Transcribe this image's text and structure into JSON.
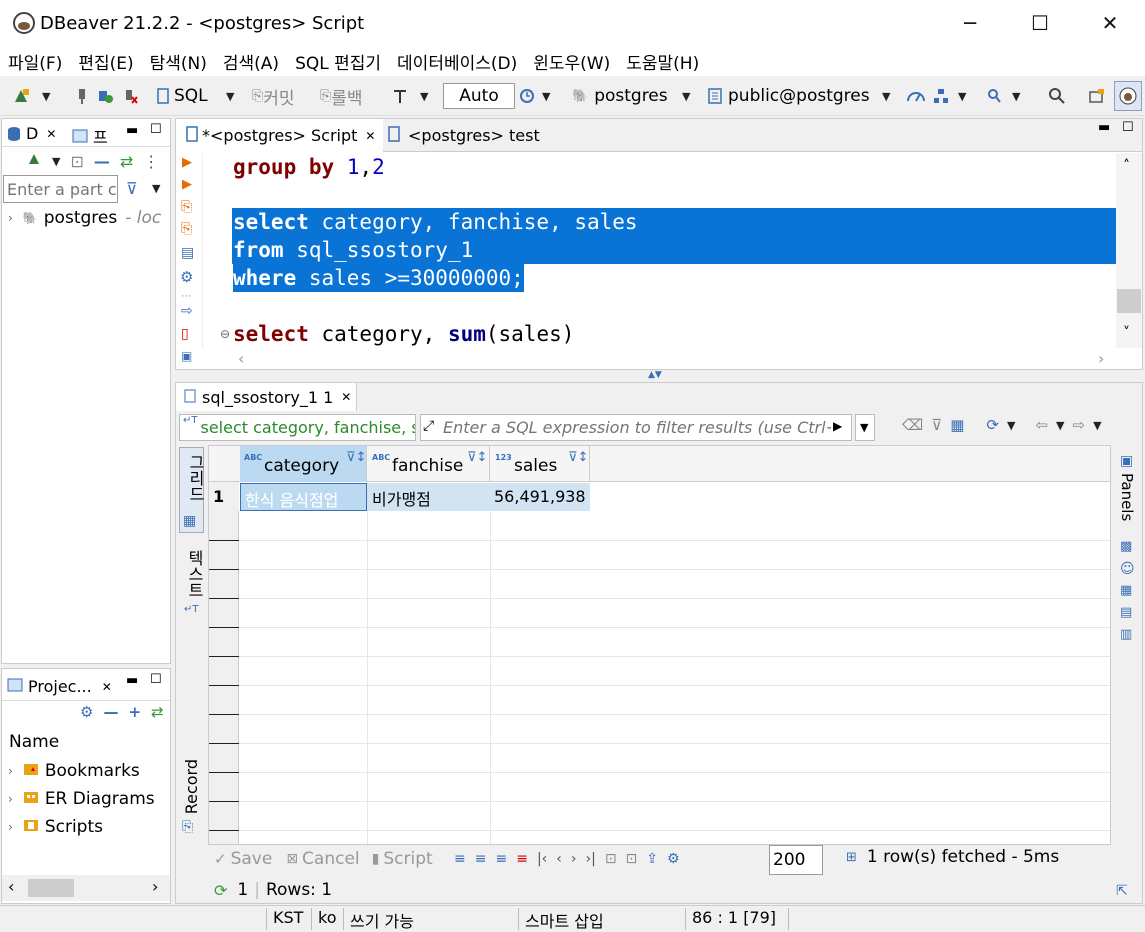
{
  "window": {
    "title": "DBeaver 21.2.2 - <postgres> Script",
    "minimize": "─",
    "maximize": "☐",
    "close": "✕"
  },
  "menu": [
    "파일(F)",
    "편집(E)",
    "탐색(N)",
    "검색(A)",
    "SQL 편집기",
    "데이터베이스(D)",
    "윈도우(W)",
    "도움말(H)"
  ],
  "toolbar": {
    "sql": "SQL",
    "commit": "커밋",
    "rollback": "롤백",
    "tx_mode": "Auto",
    "datasource": "postgres",
    "schema": "public@postgres"
  },
  "db_navigator": {
    "tab_label": "D",
    "tab2_label": "프",
    "filter_placeholder": "Enter a part c",
    "tree": [
      {
        "label": "postgres",
        "suffix": "- loc"
      }
    ]
  },
  "projects": {
    "tab_label": "Projec...",
    "header": "Name",
    "items": [
      "Bookmarks",
      "ER Diagrams",
      "Scripts"
    ]
  },
  "editor": {
    "tabs": [
      {
        "label": "*<postgres> Script",
        "active": true
      },
      {
        "label": "<postgres> test",
        "active": false
      }
    ],
    "lines": {
      "l1_kw": "group by",
      "l1_num1": "1",
      "l1_sep": ",",
      "l1_num2": "2",
      "l3_kw": "select",
      "l3_rest": " category, fanchise, sales",
      "l4_kw": "from",
      "l4_rest": " sql_ssostory_1",
      "l5_kw": "where",
      "l5_rest": " sales >=30000000;",
      "l7_kw": "select",
      "l7_mid": " category, ",
      "l7_fn": "sum",
      "l7_rest": "(sales)"
    }
  },
  "results": {
    "tab_label": "sql_ssostory_1 1",
    "query_text": "select category, fanchise, s",
    "filter_placeholder": "Enter a SQL expression to filter results (use Ctrl+S)",
    "side_tabs": {
      "grid": "그리드",
      "text": "텍스트",
      "record": "Record",
      "panels": "Panels"
    },
    "columns": [
      {
        "type": "ABC",
        "name": "category"
      },
      {
        "type": "ABC",
        "name": "fanchise"
      },
      {
        "type": "123",
        "name": "sales"
      }
    ],
    "rows": [
      {
        "num": "1",
        "cells": [
          "한식 음식점업",
          "비가맹점",
          "56,491,938"
        ]
      }
    ],
    "bottom": {
      "save": "Save",
      "cancel": "Cancel",
      "script": "Script",
      "fetch_size": "200",
      "status": "1 row(s) fetched - 5ms",
      "refresh_count": "1",
      "rows_label": "Rows: 1"
    }
  },
  "statusbar": {
    "tz": "KST",
    "locale": "ko",
    "mode": "쓰기 가능",
    "insert": "스마트 삽입",
    "pos": "86 : 1 [79]"
  },
  "colors": {
    "selection": "#0a74d6",
    "keyword": "#7f0000",
    "number": "#0000c8",
    "row_selected": "#bcd9f2"
  }
}
